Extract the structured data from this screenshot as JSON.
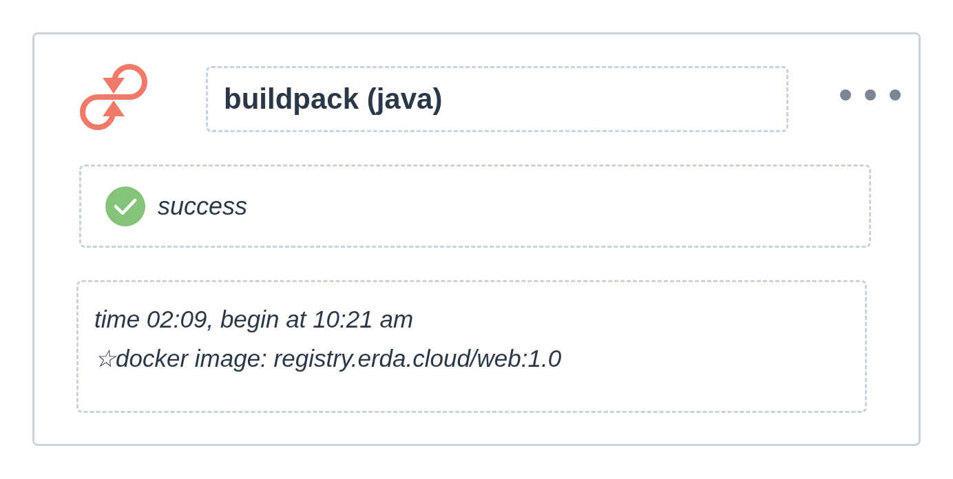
{
  "card": {
    "title": "buildpack (java)",
    "status": {
      "kind": "success",
      "label": "success"
    },
    "details": [
      "time 02:09, begin at 10:21 am",
      "☆docker image: registry.erda.cloud/web:1.0"
    ]
  }
}
